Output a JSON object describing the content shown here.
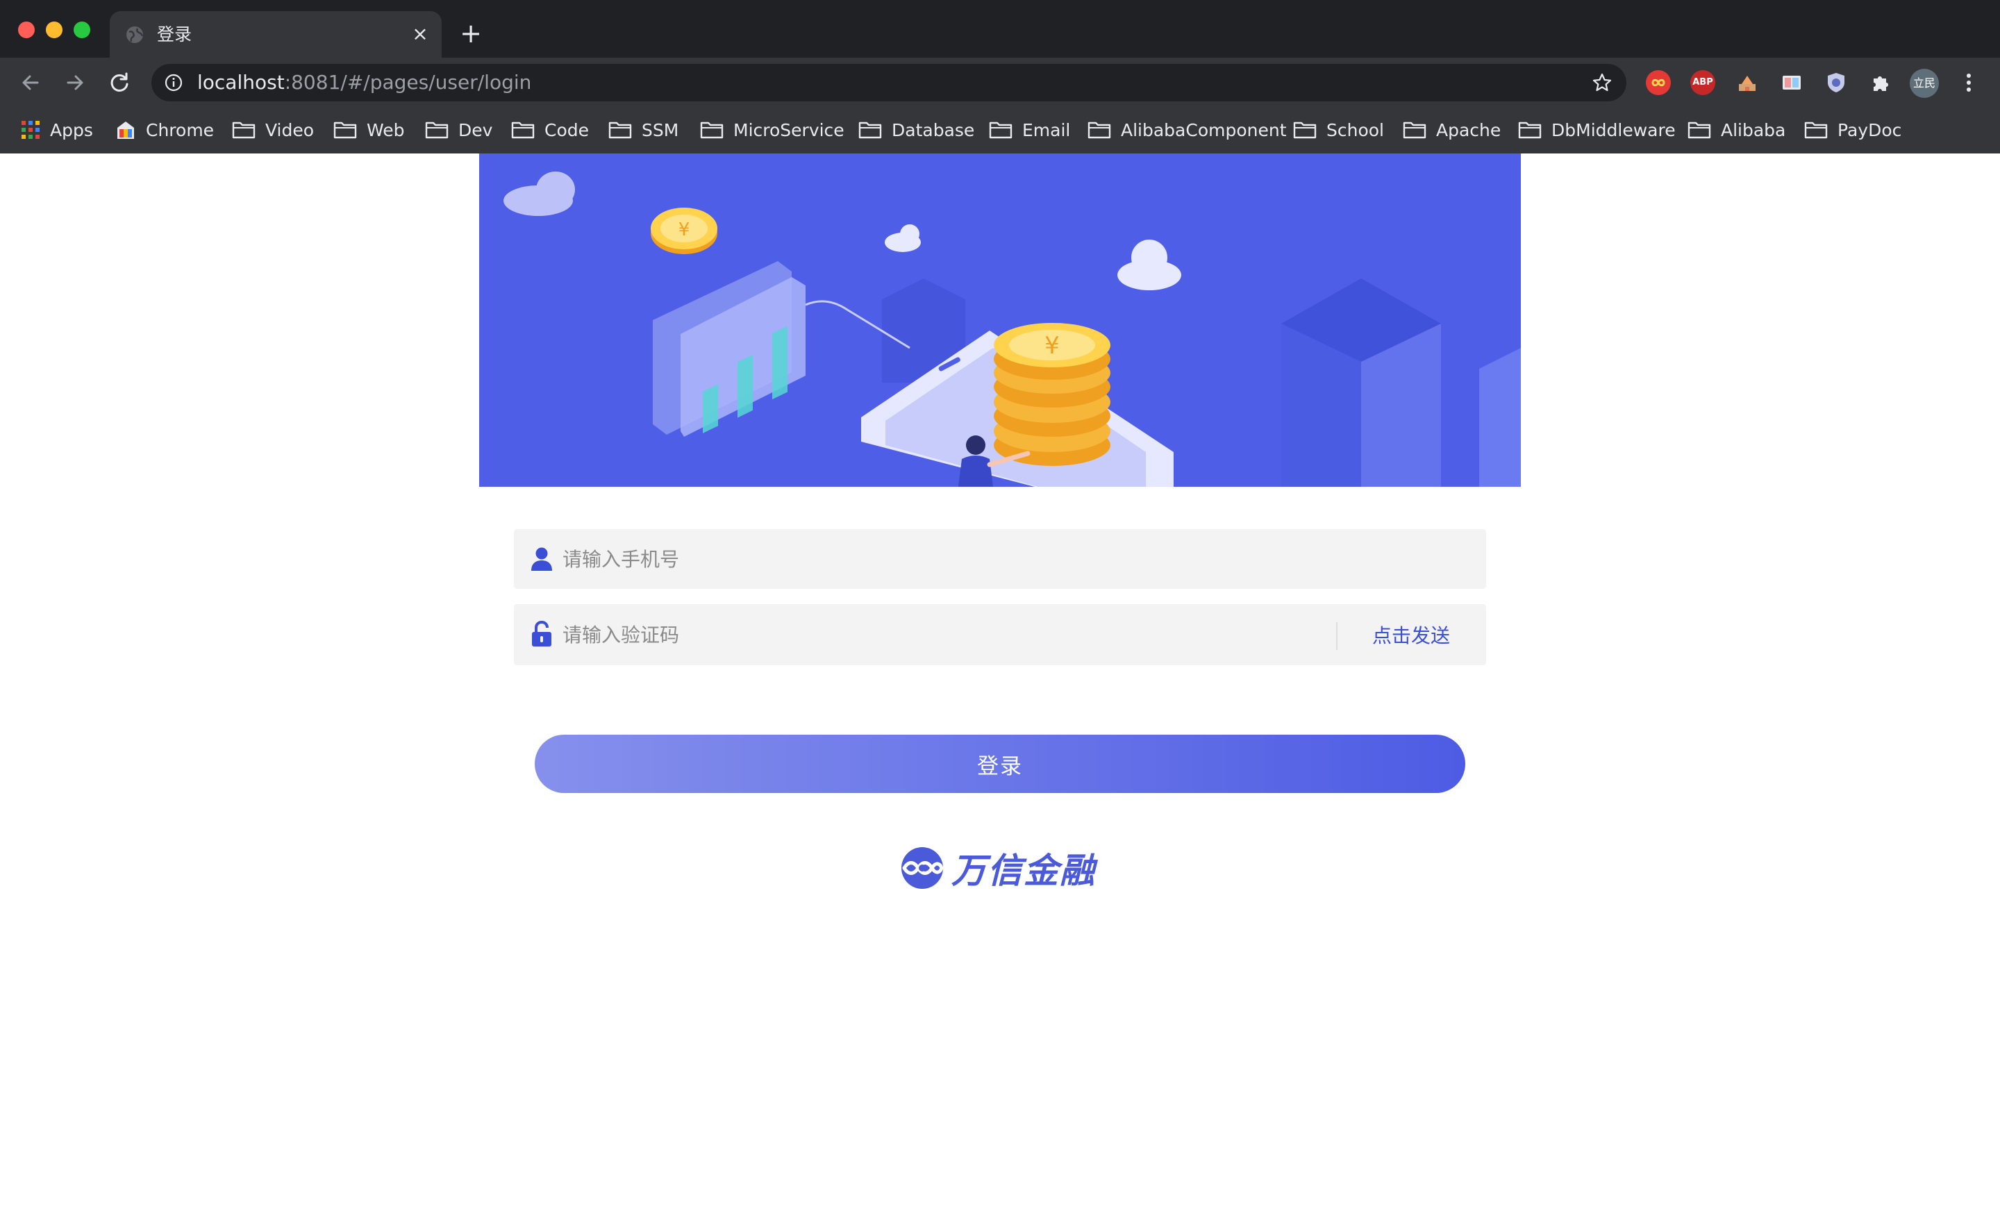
{
  "window": {
    "tab_title": "登录",
    "tab_close": "×",
    "new_tab": "+"
  },
  "address_bar": {
    "host": "localhost",
    "path": ":8081/#/pages/user/login"
  },
  "extensions": {
    "abp_label": "ABP",
    "avatar_label": "立民"
  },
  "bookmarks": [
    {
      "label": "Apps",
      "icon": "apps-grid-icon"
    },
    {
      "label": "Chrome",
      "icon": "chrome-bookmark-icon"
    },
    {
      "label": "Video",
      "icon": "folder-icon"
    },
    {
      "label": "Web",
      "icon": "folder-icon"
    },
    {
      "label": "Dev",
      "icon": "folder-icon"
    },
    {
      "label": "Code",
      "icon": "folder-icon"
    },
    {
      "label": "SSM",
      "icon": "folder-icon"
    },
    {
      "label": "MicroService",
      "icon": "folder-icon"
    },
    {
      "label": "Database",
      "icon": "folder-icon"
    },
    {
      "label": "Email",
      "icon": "folder-icon"
    },
    {
      "label": "AlibabaComponent",
      "icon": "folder-icon"
    },
    {
      "label": "School",
      "icon": "folder-icon"
    },
    {
      "label": "Apache",
      "icon": "folder-icon"
    },
    {
      "label": "DbMiddleware",
      "icon": "folder-icon"
    },
    {
      "label": "Alibaba",
      "icon": "folder-icon"
    },
    {
      "label": "PayDoc",
      "icon": "folder-icon"
    }
  ],
  "login_form": {
    "phone_placeholder": "请输入手机号",
    "phone_value": "",
    "code_placeholder": "请输入验证码",
    "code_value": "",
    "send_code_label": "点击发送",
    "submit_label": "登录"
  },
  "brand": {
    "name": "万信金融"
  },
  "colors": {
    "accent": "#4e5ee6",
    "link": "#3a4fd8",
    "field_bg": "#f3f3f3",
    "chrome_dark": "#202124",
    "chrome_toolbar": "#35363a"
  }
}
